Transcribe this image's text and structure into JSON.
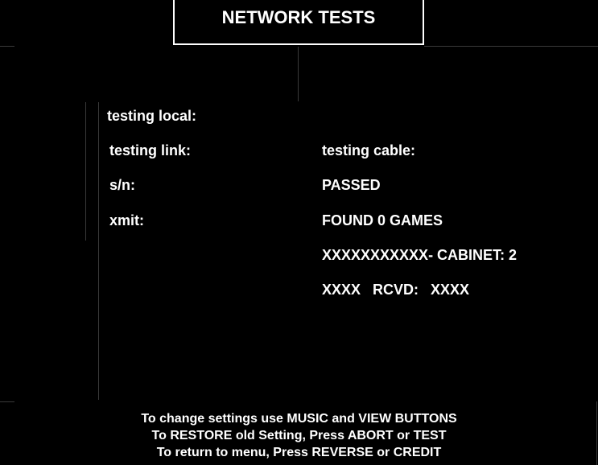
{
  "title": "NETWORK TESTS",
  "left_column": {
    "testing_local": "testing local:",
    "testing_link": "testing link:",
    "sn": "s/n:",
    "xmit": "xmit:"
  },
  "right_column": {
    "testing_cable": "testing cable:",
    "status": "PASSED",
    "found_games": "FOUND 0 GAMES",
    "serial_cabinet": "XXXXXXXXXXX- CABINET: 2",
    "xmit_rcvd": "XXXX   RCVD:   XXXX"
  },
  "footer": {
    "line1": "To change settings use MUSIC and VIEW BUTTONS",
    "line2": "To RESTORE old Setting, Press ABORT or TEST",
    "line3": "To return to menu, Press REVERSE or CREDIT"
  },
  "colors": {
    "background": "#000000",
    "text": "#ffffff"
  }
}
